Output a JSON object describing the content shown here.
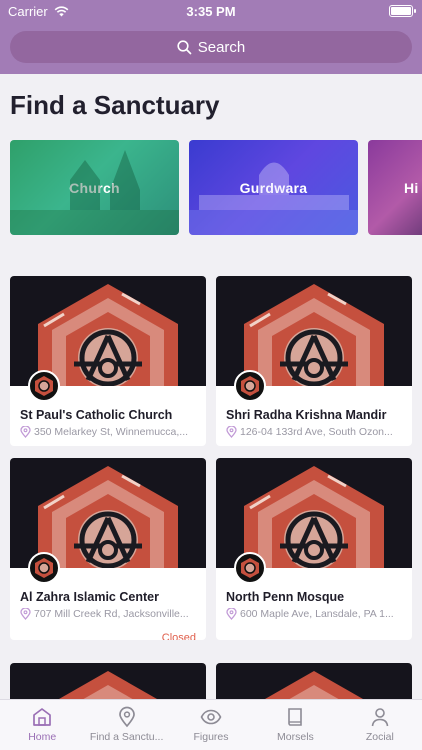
{
  "status_bar": {
    "carrier": "Carrier",
    "time": "3:35 PM",
    "wifi_icon": "wifi-icon",
    "battery_icon": "battery-icon"
  },
  "search": {
    "label": "Search",
    "icon": "search-icon"
  },
  "page_title": "Find a Sanctuary",
  "categories": [
    {
      "label": "Church"
    },
    {
      "label": "Gurdwara"
    },
    {
      "label": "Hi"
    }
  ],
  "places": [
    {
      "name": "St Paul's Catholic Church",
      "address": "350 Melarkey St, Winnemucca,...",
      "status": ""
    },
    {
      "name": "Shri Radha Krishna Mandir",
      "address": "126-04 133rd Ave, South Ozon...",
      "status": ""
    },
    {
      "name": "Al Zahra Islamic Center",
      "address": "707 Mill Creek Rd, Jacksonville...",
      "status": "Closed"
    },
    {
      "name": "North Penn Mosque",
      "address": "600 Maple Ave, Lansdale, PA 1...",
      "status": ""
    }
  ],
  "tabs": [
    {
      "label": "Home",
      "icon": "home-icon"
    },
    {
      "label": "Find a Sanctu...",
      "icon": "location-pin-icon"
    },
    {
      "label": "Figures",
      "icon": "eye-icon"
    },
    {
      "label": "Morsels",
      "icon": "book-icon"
    },
    {
      "label": "Zocial",
      "icon": "person-icon"
    }
  ],
  "colors": {
    "brand": "#a27cb6",
    "accent": "#9a6fb5",
    "closed": "#e0604d"
  }
}
